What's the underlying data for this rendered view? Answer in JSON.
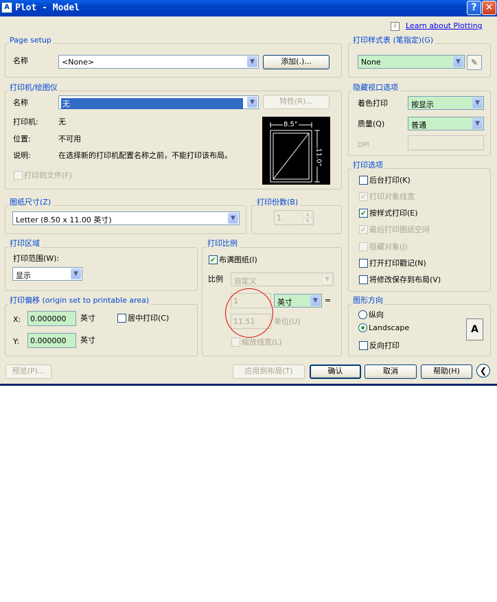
{
  "window": {
    "title": "Plot - Model",
    "app_icon": "autocad-icon",
    "help_icon_label": "?",
    "close_icon_label": "✕"
  },
  "header": {
    "learn_link": "Learn about Plotting"
  },
  "page_setup": {
    "group_label": "Page setup",
    "name_label": "名称",
    "name_value": "<None>",
    "add_button": "添加(.)..."
  },
  "printer": {
    "group_label": "打印机/绘图仪",
    "name_label": "名称",
    "name_value": "无",
    "properties_button": "特性(R)...",
    "plotter_label": "打印机:",
    "plotter_value": "无",
    "where_label": "位置:",
    "where_value": "不可用",
    "description_label": "说明:",
    "description_value": "在选择新的打印机配置名称之前，不能打印该布局。",
    "plot_to_file_label": "打印到文件(F)",
    "plot_to_file_checked": false,
    "preview_width": "8.5\"",
    "preview_height": "11.0\""
  },
  "paper_size": {
    "group_label": "图纸尺寸(Z)",
    "value": "Letter (8.50 x 11.00 英寸)"
  },
  "copies": {
    "group_label": "打印份数(B)",
    "value": "1"
  },
  "plot_area": {
    "group_label": "打印区域",
    "what_label": "打印范围(W):",
    "what_value": "显示"
  },
  "plot_offset": {
    "group_label": "打印偏移 (origin set to printable area)",
    "x_label": "X:",
    "x_value": "0.000000",
    "x_unit": "英寸",
    "y_label": "Y:",
    "y_value": "0.000000",
    "y_unit": "英寸",
    "center_label": "居中打印(C)",
    "center_checked": false
  },
  "plot_scale": {
    "group_label": "打印比例",
    "fit_label": "布满图纸(I)",
    "fit_checked": true,
    "scale_label": "比例",
    "scale_value": "自定义",
    "top_value": "1",
    "unit_value": "英寸",
    "equals": "=",
    "bottom_value": "11.51",
    "bottom_unit_label": "单位(U)",
    "lineweights_label": "缩放线宽(L)",
    "lineweights_checked": false
  },
  "style_table": {
    "group_label": "打印样式表 (笔指定)(G)",
    "value": "None"
  },
  "shaded_viewport": {
    "group_label": "隐藏视口选项",
    "shade_label": "着色打印",
    "shade_value": "按显示",
    "quality_label": "质量(Q)",
    "quality_value": "普通",
    "dpi_label": "DPI"
  },
  "plot_options": {
    "group_label": "打印选项",
    "items": [
      {
        "label": "后台打印(K)",
        "checked": false,
        "enabled": true
      },
      {
        "label": "打印对象线宽",
        "checked": true,
        "enabled": false
      },
      {
        "label": "按样式打印(E)",
        "checked": true,
        "enabled": true
      },
      {
        "label": "最后打印图纸空间",
        "checked": true,
        "enabled": false
      },
      {
        "label": "隐藏对象(J)",
        "checked": false,
        "enabled": false
      },
      {
        "label": "打开打印戳记(N)",
        "checked": false,
        "enabled": true
      },
      {
        "label": "将修改保存到布局(V)",
        "checked": false,
        "enabled": true
      }
    ]
  },
  "orientation": {
    "group_label": "图形方向",
    "portrait_label": "纵向",
    "landscape_label": "Landscape",
    "selected": "landscape",
    "upside_down_label": "反向打印",
    "upside_down_checked": false,
    "icon_letter": "A"
  },
  "footer": {
    "preview_button": "预览(P)...",
    "apply_button": "应用到布局(T)",
    "ok_button": "确认",
    "cancel_button": "取消",
    "help_button": "帮助(H)",
    "more_options_icon": "❮"
  },
  "colors": {
    "titlebar": "#0043c8",
    "dialog_bg": "#ece9d8",
    "group_label": "#0046d5",
    "field_green": "#c8f0c8",
    "selection": "#316ac5",
    "annotation_circle": "#e00000"
  }
}
